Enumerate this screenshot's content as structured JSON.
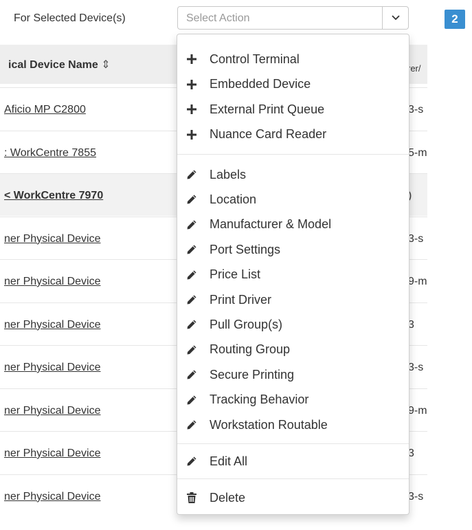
{
  "toolbar": {
    "label": "For Selected Device(s)",
    "select_placeholder": "Select Action",
    "badge": "2"
  },
  "table": {
    "name_header": "ical Device Name",
    "sort_glyph": "⇕",
    "col3_header": "rer/",
    "rows": [
      {
        "name": " Aficio MP C2800",
        "col3": "3-s"
      },
      {
        "name": ": WorkCentre 7855",
        "col3": "5-m"
      },
      {
        "name": "< WorkCentre 7970",
        "col3": ")"
      },
      {
        "name": "ner Physical Device",
        "col3": "3-s"
      },
      {
        "name": "ner Physical Device",
        "col3": "9-m"
      },
      {
        "name": "ner Physical Device",
        "col3": "3"
      },
      {
        "name": "ner Physical Device",
        "col3": "3-s"
      },
      {
        "name": "ner Physical Device",
        "col3": "9-m"
      },
      {
        "name": "ner Physical Device",
        "col3": "3"
      },
      {
        "name": "ner Physical Device",
        "col3": "3-s"
      }
    ]
  },
  "menu": {
    "add_items": [
      {
        "label": "Control Terminal",
        "icon": "plus-icon"
      },
      {
        "label": "Embedded Device",
        "icon": "plus-icon"
      },
      {
        "label": "External Print Queue",
        "icon": "plus-icon"
      },
      {
        "label": "Nuance Card Reader",
        "icon": "plus-icon"
      }
    ],
    "edit_items": [
      {
        "label": "Labels",
        "icon": "pencil-icon"
      },
      {
        "label": "Location",
        "icon": "pencil-icon"
      },
      {
        "label": "Manufacturer & Model",
        "icon": "pencil-icon"
      },
      {
        "label": "Port Settings",
        "icon": "pencil-icon"
      },
      {
        "label": "Price List",
        "icon": "pencil-icon"
      },
      {
        "label": "Print Driver",
        "icon": "pencil-icon"
      },
      {
        "label": "Pull Group(s)",
        "icon": "pencil-icon"
      },
      {
        "label": "Routing Group",
        "icon": "pencil-icon"
      },
      {
        "label": "Secure Printing",
        "icon": "pencil-icon"
      },
      {
        "label": "Tracking Behavior",
        "icon": "pencil-icon"
      },
      {
        "label": "Workstation Routable",
        "icon": "pencil-icon"
      }
    ],
    "edit_all": {
      "label": "Edit All",
      "icon": "pencil-icon"
    },
    "delete": {
      "label": "Delete",
      "icon": "trash-icon"
    }
  },
  "colors": {
    "badge": "#3a8fd1",
    "header_bg": "#eeeeee",
    "highlight_row_bg": "#f2f2f2"
  }
}
